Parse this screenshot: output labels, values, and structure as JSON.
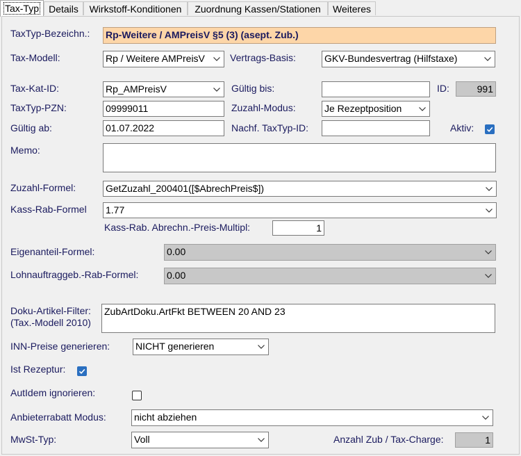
{
  "tabs": [
    {
      "label": "Tax-Typ"
    },
    {
      "label": "Details"
    },
    {
      "label": "Wirkstoff-Konditionen"
    },
    {
      "label": "Zuordnung Kassen/Stationen"
    },
    {
      "label": "Weiteres"
    }
  ],
  "form": {
    "taxtyp_bezeichnung": {
      "label": "TaxTyp-Bezeichn.:",
      "value": "Rp-Weitere / AMPreisV §5 (3) (asept. Zub.)"
    },
    "tax_modell": {
      "label": "Tax-Modell:",
      "value": "Rp / Weitere AMPreisV"
    },
    "vertrags_basis": {
      "label": "Vertrags-Basis:",
      "value": "GKV-Bundesvertrag (Hilfstaxe)"
    },
    "tax_kat_id": {
      "label": "Tax-Kat-ID:",
      "value": "Rp_AMPreisV"
    },
    "gueltig_bis": {
      "label": "Gültig bis:",
      "value": ""
    },
    "id": {
      "label": "ID:",
      "value": "991"
    },
    "taxtyp_pzn": {
      "label": "TaxTyp-PZN:",
      "value": "09999011"
    },
    "zuzahl_modus": {
      "label": "Zuzahl-Modus:",
      "value": "Je Rezeptposition"
    },
    "gueltig_ab": {
      "label": "Gültig ab:",
      "value": "01.07.2022"
    },
    "nachf_taxtyp_id": {
      "label": "Nachf. TaxTyp-ID:",
      "value": ""
    },
    "aktiv": {
      "label": "Aktiv:",
      "checked": true
    },
    "memo": {
      "label": "Memo:",
      "value": ""
    },
    "zuzahl_formel": {
      "label": "Zuzahl-Formel:",
      "value": "GetZuzahl_200401([$AbrechPreis$])"
    },
    "kass_rab_formel": {
      "label": "Kass-Rab-Formel",
      "value": "1.77"
    },
    "kass_rab_multipl": {
      "label": "Kass-Rab. Abrechn.-Preis-Multipl:",
      "value": "1"
    },
    "eigenanteil_formel": {
      "label": "Eigenanteil-Formel:",
      "value": "0.00"
    },
    "lohnauftrag_rab_formel": {
      "label": "Lohnauftraggeb.-Rab-Formel:",
      "value": "0.00"
    },
    "doku_artikel_filter": {
      "label1": "Doku-Artikel-Filter:",
      "label2": "(Tax.-Modell 2010)",
      "value": "ZubArtDoku.ArtFkt BETWEEN 20 AND 23"
    },
    "inn_preise": {
      "label": "INN-Preise generieren:",
      "value": "NICHT generieren"
    },
    "ist_rezeptur": {
      "label": "Ist Rezeptur:",
      "checked": true
    },
    "autidem_ignorieren": {
      "label": "AutIdem ignorieren:",
      "checked": false
    },
    "anbieterrabatt_modus": {
      "label": "Anbieterrabatt Modus:",
      "value": "nicht abziehen"
    },
    "mwst_typ": {
      "label": "MwSt-Typ:",
      "value": "Voll"
    },
    "anzahl_zub": {
      "label": "Anzahl Zub / Tax-Charge:",
      "value": "1"
    }
  },
  "icons": {
    "dropdown": "chevron-down-icon",
    "check": "checkmark-icon"
  },
  "colors": {
    "label": "#1a1a5e",
    "highlight": "#fdd6a8",
    "checkbox": "#2a6fc0",
    "readonly": "#c8c8c8"
  }
}
